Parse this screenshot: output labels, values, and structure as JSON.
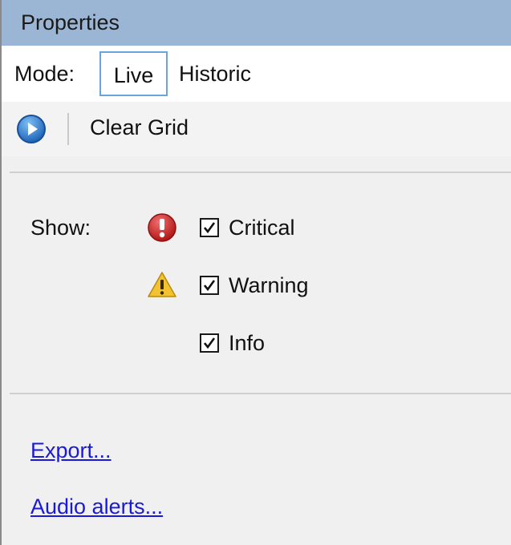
{
  "panel": {
    "title": "Properties"
  },
  "mode": {
    "label": "Mode:",
    "options": [
      "Live",
      "Historic"
    ],
    "selected": "Live"
  },
  "toolbar": {
    "play_icon": "play-circle-icon",
    "clear_grid_label": "Clear Grid"
  },
  "filters": {
    "show_label": "Show:",
    "items": [
      {
        "label": "Critical",
        "checked": true,
        "icon": "error-icon"
      },
      {
        "label": "Warning",
        "checked": true,
        "icon": "warning-icon"
      },
      {
        "label": "Info",
        "checked": true,
        "icon": ""
      }
    ]
  },
  "links": {
    "export": "Export...",
    "audio_alerts": "Audio alerts..."
  },
  "colors": {
    "title_bar": "#9bb5d4",
    "selected_border": "#6aa4dc",
    "link": "#1a1ad6",
    "error_red": "#cc1f1f",
    "warning_yellow": "#f2c230",
    "play_blue": "#2f7fd6"
  }
}
